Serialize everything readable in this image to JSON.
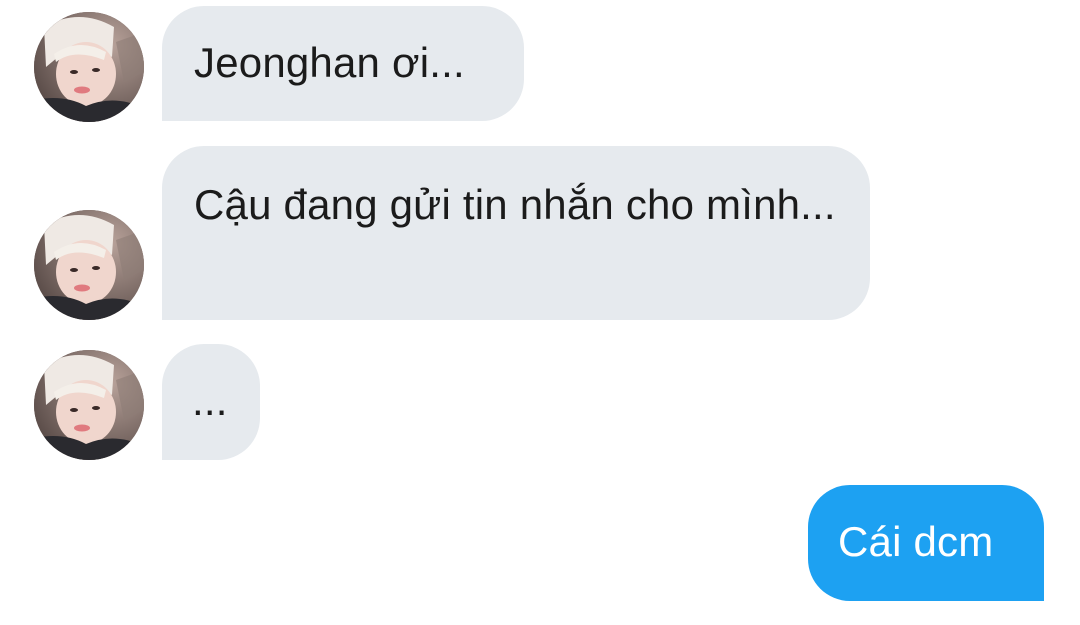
{
  "messages": [
    {
      "direction": "incoming",
      "text": "Jeonghan ơi..."
    },
    {
      "direction": "incoming",
      "text": "Cậu đang gửi tin nhắn cho mình..."
    },
    {
      "direction": "incoming",
      "text": "..."
    },
    {
      "direction": "outgoing",
      "text": "Cái dcm"
    }
  ],
  "colors": {
    "incoming_bubble": "#e6eaee",
    "outgoing_bubble": "#1da1f2",
    "incoming_text": "#1b1b1b",
    "outgoing_text": "#ffffff"
  },
  "icons": {
    "avatar": "user-avatar-photo"
  }
}
